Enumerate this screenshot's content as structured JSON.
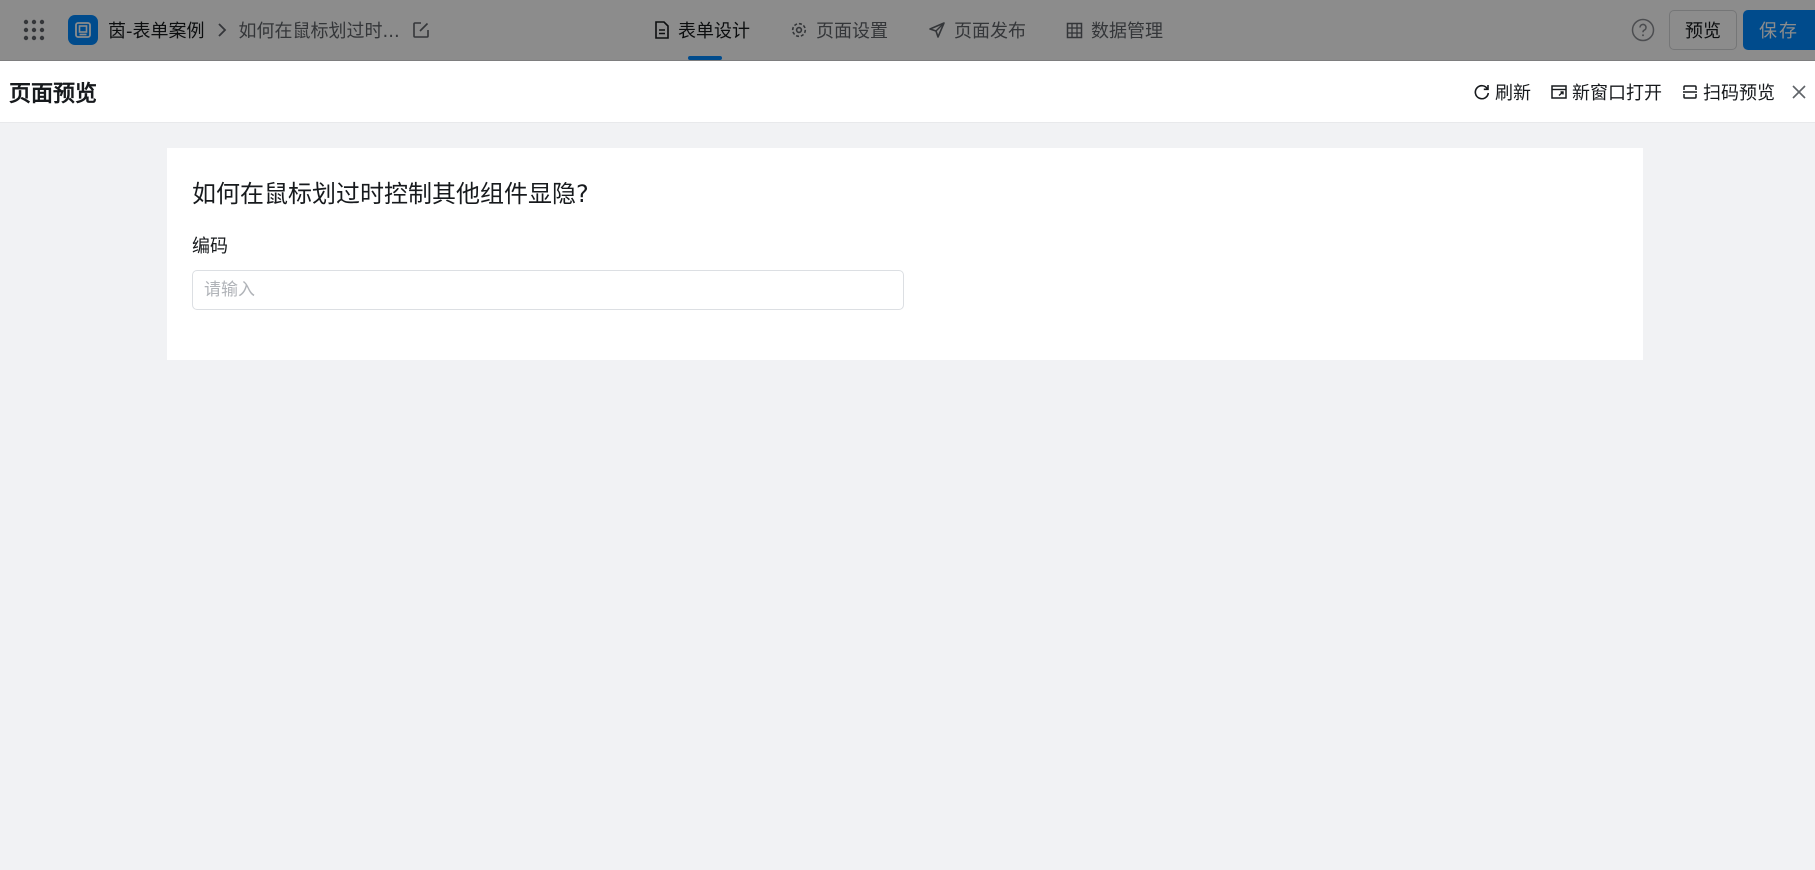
{
  "topbar": {
    "app_name": "茵-表单案例",
    "page_name": "如何在鼠标划过时...",
    "nav": [
      {
        "label": "表单设计",
        "icon": "document-icon",
        "active": true
      },
      {
        "label": "页面设置",
        "icon": "gear-icon",
        "active": false
      },
      {
        "label": "页面发布",
        "icon": "send-icon",
        "active": false
      },
      {
        "label": "数据管理",
        "icon": "table-icon",
        "active": false
      }
    ],
    "preview_label": "预览",
    "save_label": "保存"
  },
  "preview": {
    "title": "页面预览",
    "actions": {
      "refresh": "刷新",
      "open_new_window": "新窗口打开",
      "scan_preview": "扫码预览"
    }
  },
  "form": {
    "title": "如何在鼠标划过时控制其他组件显隐?",
    "field_label": "编码",
    "field_placeholder": "请输入",
    "field_value": ""
  },
  "colors": {
    "accent": "#0089ff",
    "background": "#f1f2f4",
    "mask": "rgba(0,0,0,0.45)"
  }
}
